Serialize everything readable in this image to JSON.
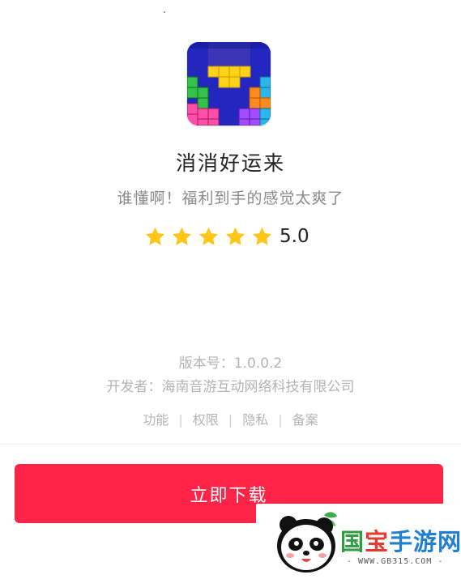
{
  "app": {
    "icon": "block-puzzle-app-icon",
    "name": "消消好运来",
    "slogan": "谁懂啊！福利到手的感觉太爽了",
    "rating": {
      "stars": 5,
      "max_stars": 5,
      "value_label": "5.0",
      "star_color": "#ffc61a"
    }
  },
  "meta": {
    "version": "版本号：1.0.0.2",
    "developer": "开发者：海南音游互动网络科技有限公司"
  },
  "links": [
    {
      "label": "功能"
    },
    {
      "label": "权限"
    },
    {
      "label": "隐私"
    },
    {
      "label": "备案"
    }
  ],
  "links_separator": "|",
  "download": {
    "label": "立即下载",
    "color": "#fd2447"
  },
  "watermark": {
    "logo": "panda-logo-icon",
    "title_parts": [
      "国",
      "宝",
      "手游网"
    ],
    "url": "- WWW.GB315.COM -"
  }
}
